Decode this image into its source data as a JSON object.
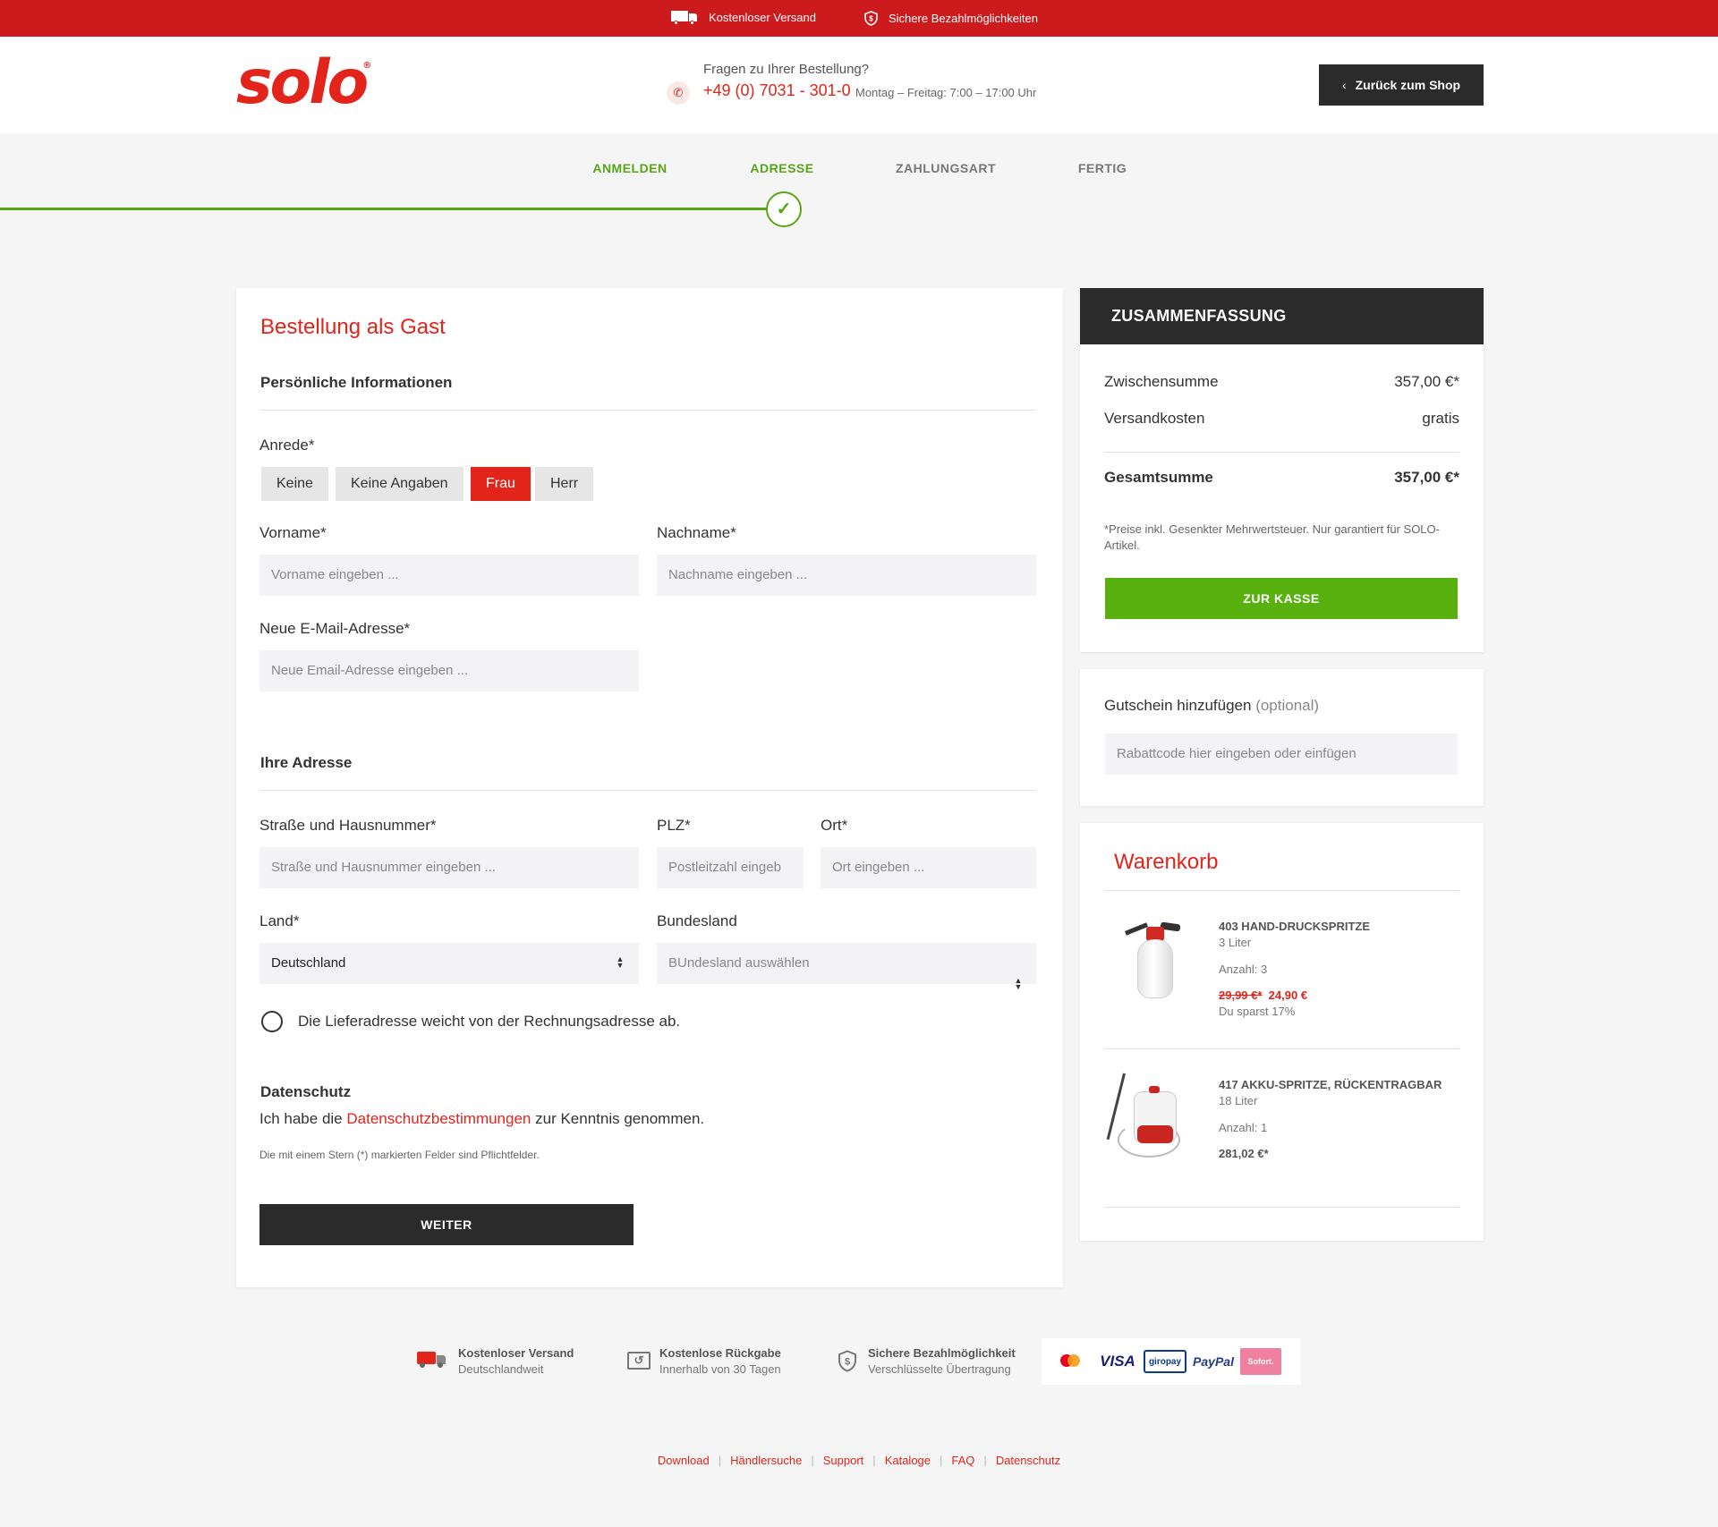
{
  "topbar": {
    "shipping": "Kostenloser Versand",
    "payment": "Sichere Bezahlmöglichkeiten"
  },
  "header": {
    "logo": "solo",
    "question": "Fragen zu Ihrer Bestellung?",
    "phone": "+49 (0) 7031 - 301-0",
    "hours": "Montag – Freitag: 7:00 – 17:00 Uhr",
    "back_label": "Zurück zum Shop"
  },
  "steps": [
    {
      "label": "ANMELDEN",
      "state": "done"
    },
    {
      "label": "ADRESSE",
      "state": "current"
    },
    {
      "label": "ZAHLUNGSART",
      "state": "todo"
    },
    {
      "label": "FERTIG",
      "state": "todo"
    }
  ],
  "form": {
    "title": "Bestellung als Gast",
    "personal_title": "Persönliche Informationen",
    "salutation_label": "Anrede*",
    "salutations": [
      "Keine",
      "Keine Angaben",
      "Frau",
      "Herr"
    ],
    "salutation_selected": "Frau",
    "firstname_label": "Vorname*",
    "firstname_placeholder": "Vorname eingeben ...",
    "lastname_label": "Nachname*",
    "lastname_placeholder": "Nachname eingeben ...",
    "email_label": "Neue E-Mail-Adresse*",
    "email_placeholder": "Neue Email-Adresse eingeben ...",
    "address_title": "Ihre Adresse",
    "street_label": "Straße und Hausnummer*",
    "street_placeholder": "Straße und Hausnummer eingeben ...",
    "zip_label": "PLZ*",
    "zip_placeholder": "Postleitzahl eingeb",
    "city_label": "Ort*",
    "city_placeholder": "Ort eingeben ...",
    "country_label": "Land*",
    "country_value": "Deutschland",
    "state_label": "Bundesland",
    "state_placeholder": "BUndesland auswählen",
    "shipping_differs": "Die Lieferadresse weicht von der Rechnungsadresse ab.",
    "privacy_title": "Datenschutz",
    "privacy_pre": "Ich habe die",
    "privacy_link": "Datenschutzbestimmungen",
    "privacy_post": "zur Kenntnis genommen.",
    "required_note": "Die mit einem Stern (*) markierten Felder sind Pflichtfelder.",
    "next_label": "WEITER"
  },
  "summary": {
    "title": "ZUSAMMENFASSUNG",
    "subtotal_label": "Zwischensumme",
    "subtotal_value": "357,00 €*",
    "shipping_label": "Versandkosten",
    "shipping_value": "gratis",
    "total_label": "Gesamtsumme",
    "total_value": "357,00 €*",
    "note": "*Preise inkl. Gesenkter Mehrwertsteuer. Nur garantiert für SOLO-Artikel.",
    "checkout_label": "ZUR KASSE"
  },
  "coupon": {
    "title": "Gutschein hinzufügen",
    "optional": "(optional)",
    "placeholder": "Rabattcode hier eingeben oder einfügen"
  },
  "cart": {
    "title": "Warenkorb",
    "items": [
      {
        "name": "403 HAND-DRUCKSPRITZE",
        "variant": "3 Liter",
        "qty": "Anzahl: 3",
        "old_price": "29,99 €*",
        "price": "24,90 €",
        "saving": "Du sparst 17%"
      },
      {
        "name": "417 AKKU-SPRITZE, RÜCKENTRAGBAR",
        "variant": "18 Liter",
        "qty": "Anzahl: 1",
        "price": "281,02 €*"
      }
    ]
  },
  "footer": {
    "features": [
      {
        "title": "Kostenloser Versand",
        "sub": "Deutschlandweit"
      },
      {
        "title": "Kostenlose Rückgabe",
        "sub": "Innerhalb von 30 Tagen"
      },
      {
        "title": "Sichere Bezahlmöglichkeit",
        "sub": "Verschlüsselte Übertragung"
      }
    ],
    "payments": [
      "mastercard",
      "VISA",
      "giropay",
      "PayPal",
      "Sofort."
    ],
    "links": [
      "Download",
      "Händlersuche",
      "Support",
      "Kataloge",
      "FAQ",
      "Datenschutz"
    ]
  },
  "colors": {
    "brand_red": "#e3241b",
    "topbar_red": "#cc1a1d",
    "success_green": "#58b10f",
    "dark": "#2b2b2b"
  }
}
